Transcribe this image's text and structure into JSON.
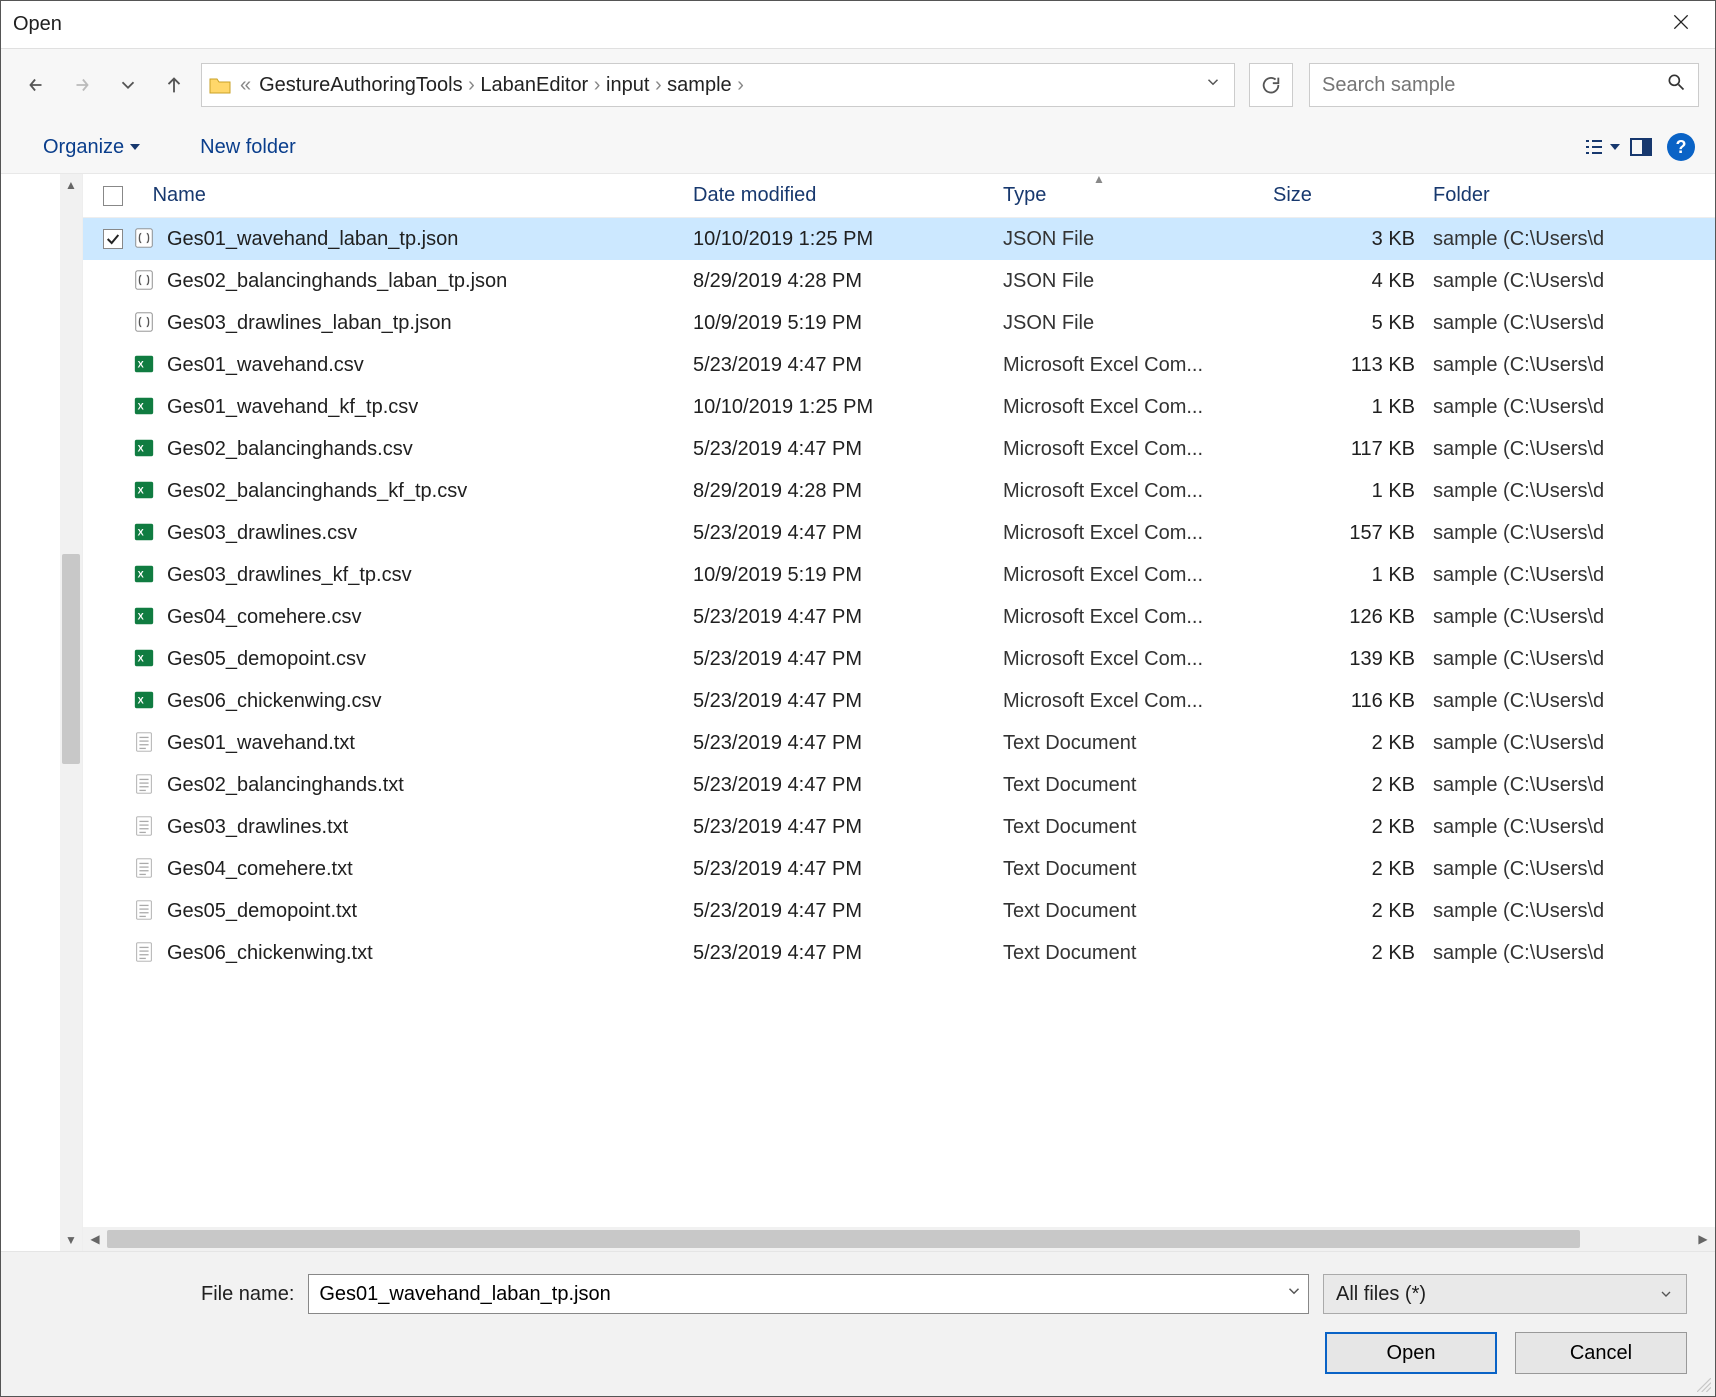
{
  "window_title": "Open",
  "breadcrumb": [
    "GestureAuthoringTools",
    "LabanEditor",
    "input",
    "sample"
  ],
  "search_placeholder": "Search sample",
  "toolbar": {
    "organize": "Organize",
    "new_folder": "New folder"
  },
  "columns": {
    "name": "Name",
    "date": "Date modified",
    "type": "Type",
    "size": "Size",
    "folder": "Folder"
  },
  "files": [
    {
      "selected": true,
      "icon": "json",
      "name": "Ges01_wavehand_laban_tp.json",
      "date": "10/10/2019 1:25 PM",
      "type": "JSON File",
      "size": "3 KB",
      "folder": "sample (C:\\Users\\d"
    },
    {
      "selected": false,
      "icon": "json",
      "name": "Ges02_balancinghands_laban_tp.json",
      "date": "8/29/2019 4:28 PM",
      "type": "JSON File",
      "size": "4 KB",
      "folder": "sample (C:\\Users\\d"
    },
    {
      "selected": false,
      "icon": "json",
      "name": "Ges03_drawlines_laban_tp.json",
      "date": "10/9/2019 5:19 PM",
      "type": "JSON File",
      "size": "5 KB",
      "folder": "sample (C:\\Users\\d"
    },
    {
      "selected": false,
      "icon": "xls",
      "name": "Ges01_wavehand.csv",
      "date": "5/23/2019 4:47 PM",
      "type": "Microsoft Excel Com...",
      "size": "113 KB",
      "folder": "sample (C:\\Users\\d"
    },
    {
      "selected": false,
      "icon": "xls",
      "name": "Ges01_wavehand_kf_tp.csv",
      "date": "10/10/2019 1:25 PM",
      "type": "Microsoft Excel Com...",
      "size": "1 KB",
      "folder": "sample (C:\\Users\\d"
    },
    {
      "selected": false,
      "icon": "xls",
      "name": "Ges02_balancinghands.csv",
      "date": "5/23/2019 4:47 PM",
      "type": "Microsoft Excel Com...",
      "size": "117 KB",
      "folder": "sample (C:\\Users\\d"
    },
    {
      "selected": false,
      "icon": "xls",
      "name": "Ges02_balancinghands_kf_tp.csv",
      "date": "8/29/2019 4:28 PM",
      "type": "Microsoft Excel Com...",
      "size": "1 KB",
      "folder": "sample (C:\\Users\\d"
    },
    {
      "selected": false,
      "icon": "xls",
      "name": "Ges03_drawlines.csv",
      "date": "5/23/2019 4:47 PM",
      "type": "Microsoft Excel Com...",
      "size": "157 KB",
      "folder": "sample (C:\\Users\\d"
    },
    {
      "selected": false,
      "icon": "xls",
      "name": "Ges03_drawlines_kf_tp.csv",
      "date": "10/9/2019 5:19 PM",
      "type": "Microsoft Excel Com...",
      "size": "1 KB",
      "folder": "sample (C:\\Users\\d"
    },
    {
      "selected": false,
      "icon": "xls",
      "name": "Ges04_comehere.csv",
      "date": "5/23/2019 4:47 PM",
      "type": "Microsoft Excel Com...",
      "size": "126 KB",
      "folder": "sample (C:\\Users\\d"
    },
    {
      "selected": false,
      "icon": "xls",
      "name": "Ges05_demopoint.csv",
      "date": "5/23/2019 4:47 PM",
      "type": "Microsoft Excel Com...",
      "size": "139 KB",
      "folder": "sample (C:\\Users\\d"
    },
    {
      "selected": false,
      "icon": "xls",
      "name": "Ges06_chickenwing.csv",
      "date": "5/23/2019 4:47 PM",
      "type": "Microsoft Excel Com...",
      "size": "116 KB",
      "folder": "sample (C:\\Users\\d"
    },
    {
      "selected": false,
      "icon": "txt",
      "name": "Ges01_wavehand.txt",
      "date": "5/23/2019 4:47 PM",
      "type": "Text Document",
      "size": "2 KB",
      "folder": "sample (C:\\Users\\d"
    },
    {
      "selected": false,
      "icon": "txt",
      "name": "Ges02_balancinghands.txt",
      "date": "5/23/2019 4:47 PM",
      "type": "Text Document",
      "size": "2 KB",
      "folder": "sample (C:\\Users\\d"
    },
    {
      "selected": false,
      "icon": "txt",
      "name": "Ges03_drawlines.txt",
      "date": "5/23/2019 4:47 PM",
      "type": "Text Document",
      "size": "2 KB",
      "folder": "sample (C:\\Users\\d"
    },
    {
      "selected": false,
      "icon": "txt",
      "name": "Ges04_comehere.txt",
      "date": "5/23/2019 4:47 PM",
      "type": "Text Document",
      "size": "2 KB",
      "folder": "sample (C:\\Users\\d"
    },
    {
      "selected": false,
      "icon": "txt",
      "name": "Ges05_demopoint.txt",
      "date": "5/23/2019 4:47 PM",
      "type": "Text Document",
      "size": "2 KB",
      "folder": "sample (C:\\Users\\d"
    },
    {
      "selected": false,
      "icon": "txt",
      "name": "Ges06_chickenwing.txt",
      "date": "5/23/2019 4:47 PM",
      "type": "Text Document",
      "size": "2 KB",
      "folder": "sample (C:\\Users\\d"
    }
  ],
  "filename_label": "File name:",
  "filename_value": "Ges01_wavehand_laban_tp.json",
  "filter_value": "All files (*)",
  "open_label": "Open",
  "cancel_label": "Cancel"
}
